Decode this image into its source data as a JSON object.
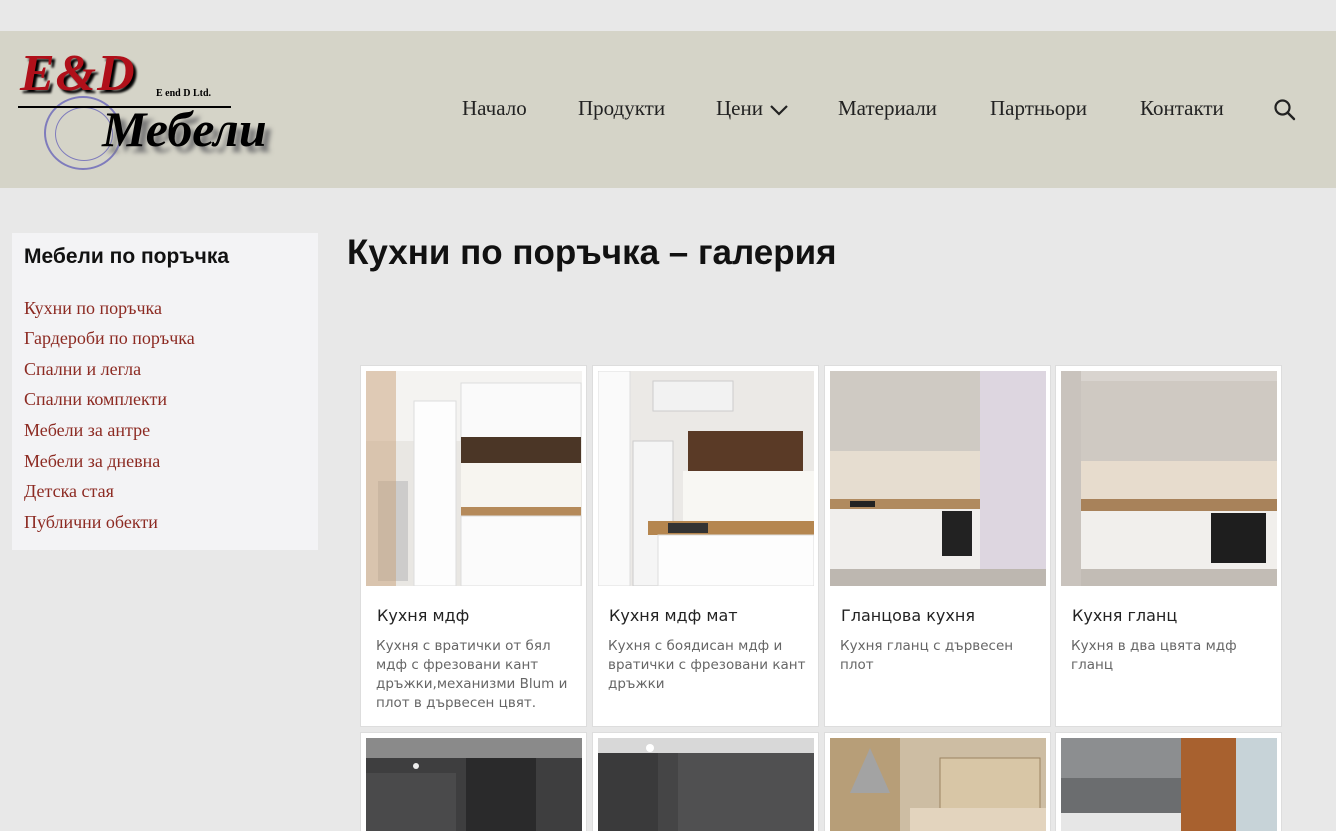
{
  "logo": {
    "brand": "E&D",
    "ltd": "E end D Ltd.",
    "word": "Мебели"
  },
  "nav": {
    "items": [
      {
        "label": "Начало"
      },
      {
        "label": "Продукти"
      },
      {
        "label": "Цени"
      },
      {
        "label": "Материали"
      },
      {
        "label": "Партньори"
      },
      {
        "label": "Контакти"
      }
    ],
    "search_icon": "search-icon",
    "dropdown_icon": "chevron-down-icon"
  },
  "sidebar": {
    "title": "Мебели по поръчка",
    "links": [
      "Кухни по поръчка",
      "Гардероби по поръчка",
      "Спални и легла",
      "Спални комплекти",
      "Мебели за антре",
      "Мебели за дневна",
      "Детска стая",
      "Публични обекти"
    ]
  },
  "page": {
    "title": "Кухни по поръчка – галерия"
  },
  "gallery": [
    {
      "caption": "Кухня мдф",
      "desc": "Кухня с вратички от бял мдф с фрезовани кант дръжки,механизми Blum и плот в дървесен цвят."
    },
    {
      "caption": "Кухня мдф мат",
      "desc": "Кухня с боядисан мдф и вратички с фрезовани кант дръжки"
    },
    {
      "caption": "Гланцова кухня",
      "desc": "Кухня гланц с дървесен плот"
    },
    {
      "caption": "Кухня гланц",
      "desc": "Кухня в два цвята мдф гланц"
    }
  ],
  "colors": {
    "header_bg": "#d5d4c8",
    "page_bg": "#e8e8e8",
    "link": "#8c2a22",
    "brand_red": "#b0101a"
  }
}
